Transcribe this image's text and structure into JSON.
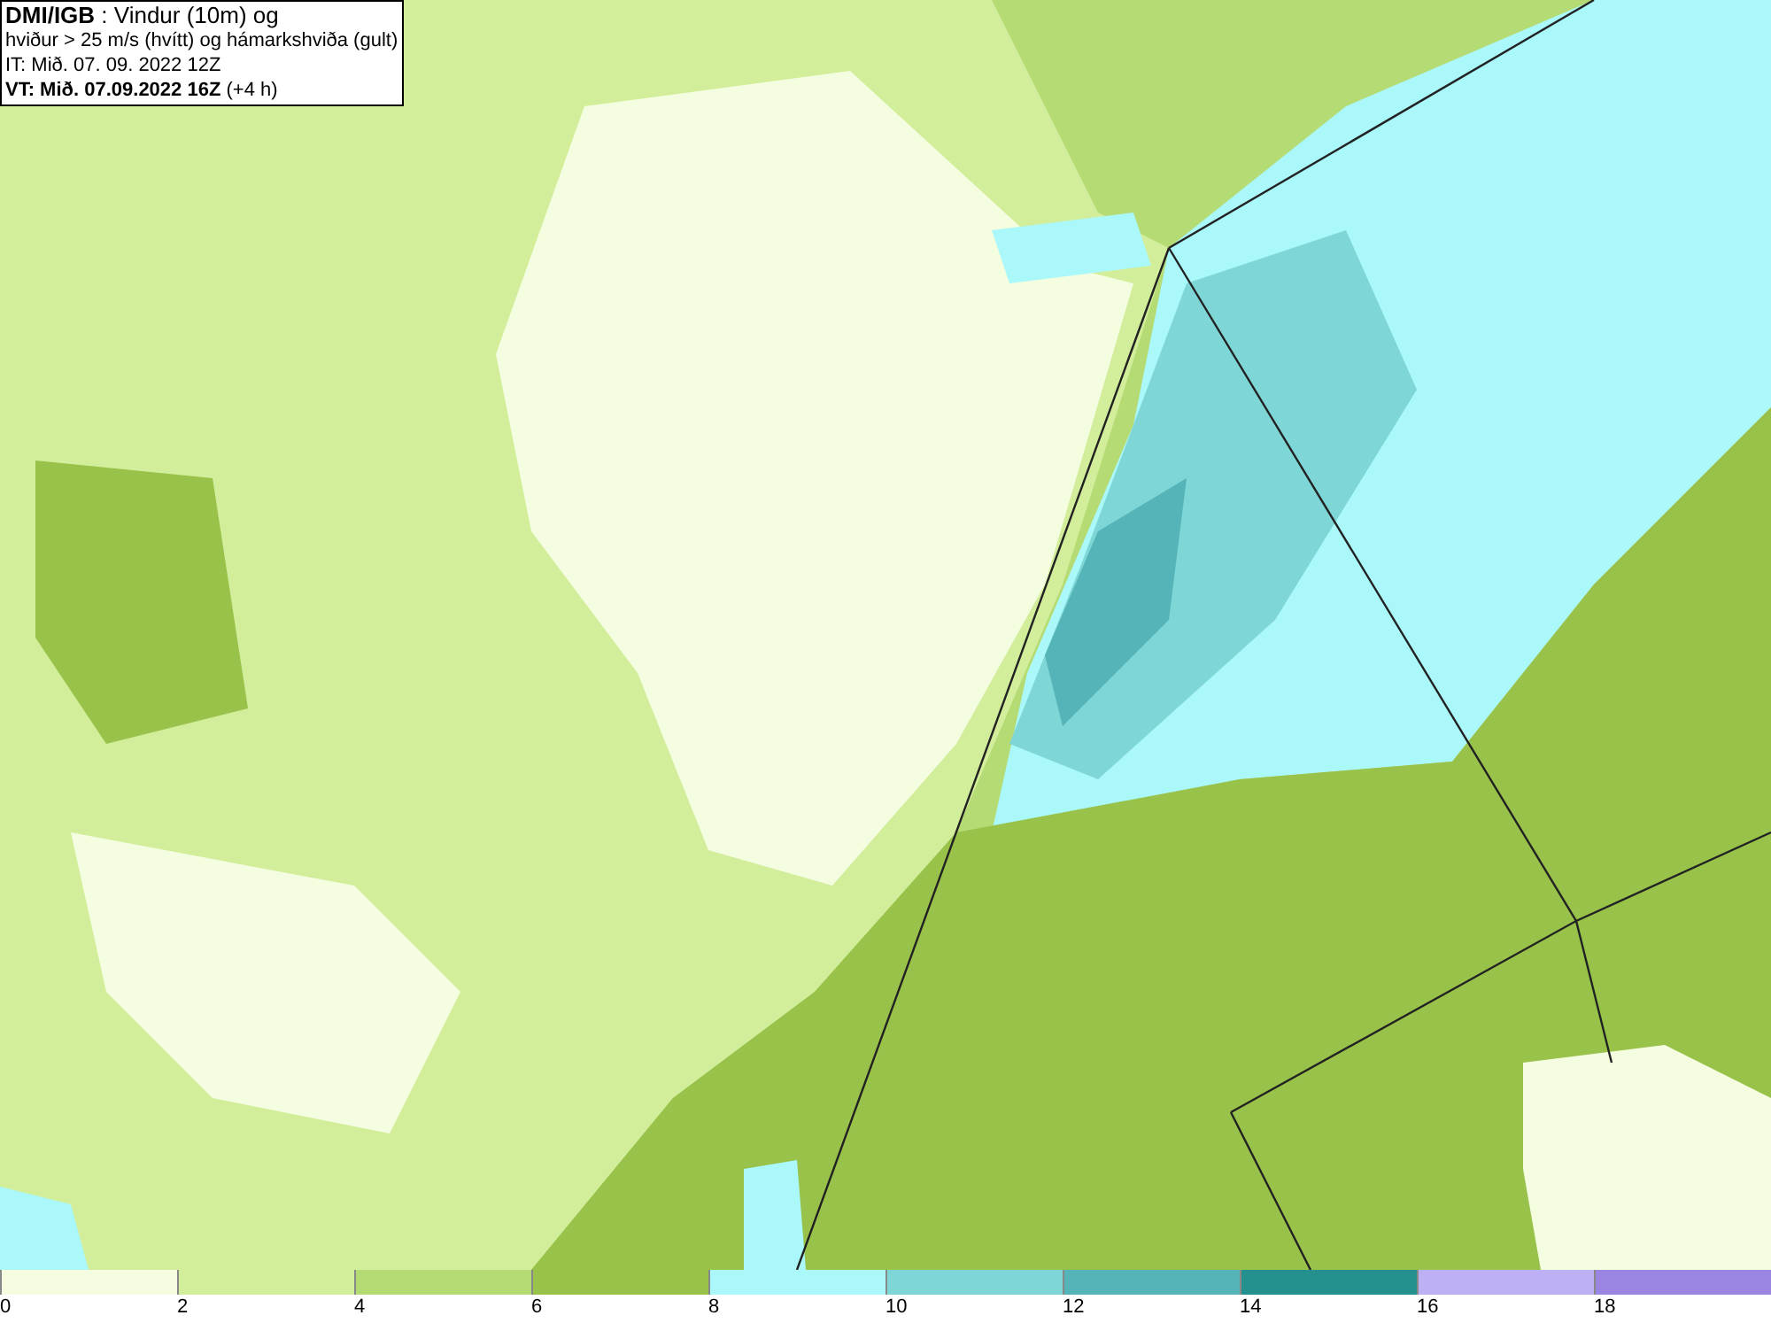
{
  "title_box": {
    "lines": [
      "**DMI/IGB** : Vindur (10m) og",
      "hviður > 25 m/s (hvítt) og hámarkshviða (gult)",
      "IT: Mið. 07. 09. 2022 12Z",
      "**VT: Mið. 07.09.2022 16Z** (+4 h)"
    ]
  },
  "legend": {
    "bins": [
      {
        "label": "0",
        "color": "#f5fde0"
      },
      {
        "label": "2",
        "color": "#d2ee9a"
      },
      {
        "label": "4",
        "color": "#b5db75"
      },
      {
        "label": "6",
        "color": "#98c24a"
      },
      {
        "label": "8",
        "color": "#aaf8fa"
      },
      {
        "label": "10",
        "color": "#7fd6d6"
      },
      {
        "label": "12",
        "color": "#55b4b8"
      },
      {
        "label": "14",
        "color": "#24918f"
      },
      {
        "label": "16",
        "color": "#bdb0f5"
      },
      {
        "label": "18",
        "color": "#9a85e3"
      }
    ]
  }
}
